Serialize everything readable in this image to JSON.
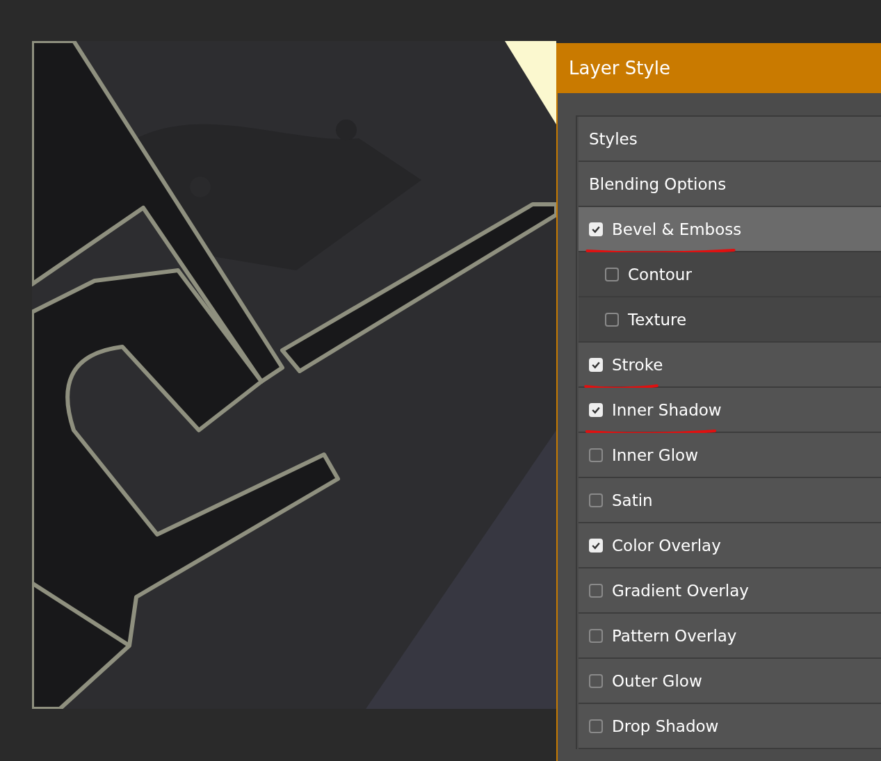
{
  "dialog": {
    "title": "Layer Style",
    "items": [
      {
        "kind": "plain",
        "label": "Styles",
        "selected": false
      },
      {
        "kind": "plain",
        "label": "Blending Options",
        "selected": false
      },
      {
        "kind": "option",
        "label": "Bevel & Emboss",
        "checked": true,
        "selected": true,
        "underlined": true,
        "children": [
          {
            "kind": "option",
            "label": "Contour",
            "checked": false,
            "selected": false,
            "underlined": false
          },
          {
            "kind": "option",
            "label": "Texture",
            "checked": false,
            "selected": false,
            "underlined": false
          }
        ]
      },
      {
        "kind": "option",
        "label": "Stroke",
        "checked": true,
        "selected": false,
        "underlined": true
      },
      {
        "kind": "option",
        "label": "Inner Shadow",
        "checked": true,
        "selected": false,
        "underlined": true
      },
      {
        "kind": "option",
        "label": "Inner Glow",
        "checked": false,
        "selected": false,
        "underlined": false
      },
      {
        "kind": "option",
        "label": "Satin",
        "checked": false,
        "selected": false,
        "underlined": false
      },
      {
        "kind": "option",
        "label": "Color Overlay",
        "checked": true,
        "selected": false,
        "underlined": false
      },
      {
        "kind": "option",
        "label": "Gradient Overlay",
        "checked": false,
        "selected": false,
        "underlined": false
      },
      {
        "kind": "option",
        "label": "Pattern Overlay",
        "checked": false,
        "selected": false,
        "underlined": false
      },
      {
        "kind": "option",
        "label": "Outer Glow",
        "checked": false,
        "selected": false,
        "underlined": false
      },
      {
        "kind": "option",
        "label": "Drop Shadow",
        "checked": false,
        "selected": false,
        "underlined": false
      }
    ]
  }
}
